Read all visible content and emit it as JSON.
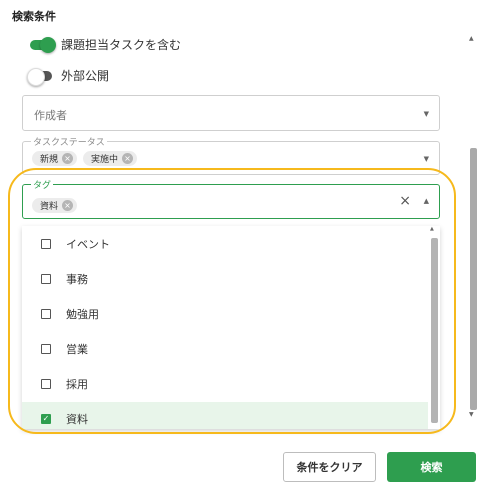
{
  "title": "検索条件",
  "toggles": [
    {
      "label": "課題担当タスクを含む",
      "on": true
    },
    {
      "label": "外部公開",
      "on": false
    }
  ],
  "author_field": {
    "placeholder": "作成者"
  },
  "status_field": {
    "legend": "タスクステータス",
    "chips": [
      "新規",
      "実施中"
    ]
  },
  "tag_field": {
    "legend": "タグ",
    "chips": [
      "資料"
    ]
  },
  "tag_options": [
    {
      "label": "イベント",
      "checked": false
    },
    {
      "label": "事務",
      "checked": false
    },
    {
      "label": "勉強用",
      "checked": false
    },
    {
      "label": "営業",
      "checked": false
    },
    {
      "label": "採用",
      "checked": false
    },
    {
      "label": "資料",
      "checked": true
    }
  ],
  "buttons": {
    "clear": "条件をクリア",
    "search": "検索"
  },
  "colors": {
    "accent": "#2e9e4f",
    "highlight": "#f6b91c",
    "toggle_off": "#555555"
  }
}
